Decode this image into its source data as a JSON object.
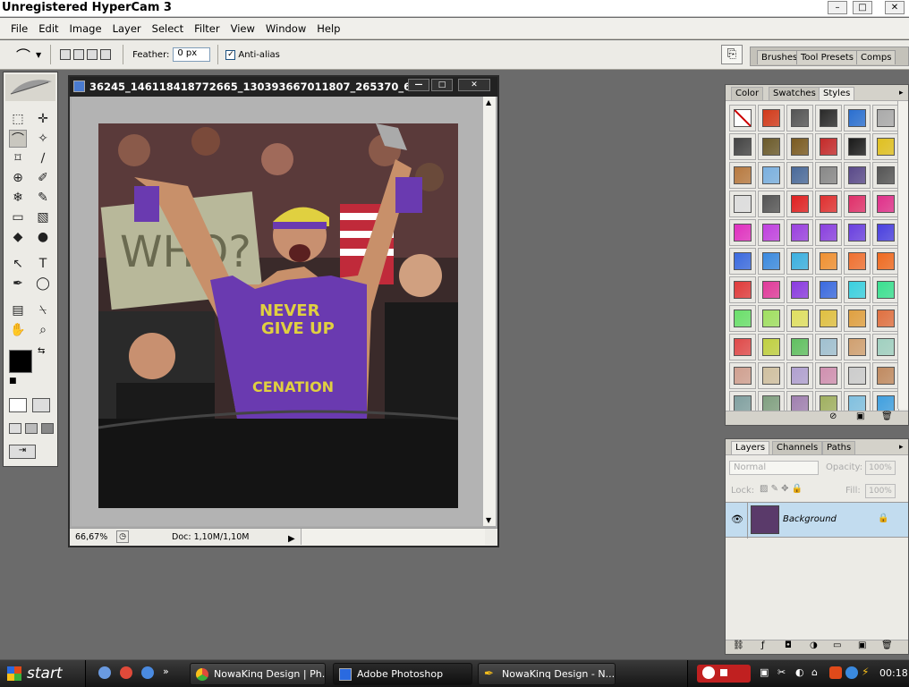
{
  "window": {
    "title": "Unregistered HyperCam 3",
    "min": "–",
    "max": "□",
    "close": "✕"
  },
  "menu": [
    "File",
    "Edit",
    "Image",
    "Layer",
    "Select",
    "Filter",
    "View",
    "Window",
    "Help"
  ],
  "options": {
    "feather_label": "Feather:",
    "feather_value": "0 px",
    "antialias_label": "Anti-alias",
    "antialias_checked": "✓"
  },
  "palette_tabs": [
    "Brushes",
    "Tool Presets",
    "Comps"
  ],
  "toolbox": {
    "icons": [
      "marquee-icon",
      "move-icon",
      "polygonal-lasso-icon",
      "magic-wand-icon",
      "crop-icon",
      "slice-icon",
      "healing-brush-icon",
      "brush-icon",
      "clone-stamp-icon",
      "history-brush-icon",
      "eraser-icon",
      "gradient-icon",
      "blur-icon",
      "dodge-icon",
      "path-selection-icon",
      "type-icon",
      "pen-icon",
      "shape-icon",
      "notes-icon",
      "eyedropper-icon",
      "hand-icon",
      "zoom-icon"
    ],
    "glyphs": [
      "⬚",
      "✛",
      "⌒",
      "✧",
      "⌑",
      "∕",
      "⊕",
      "✐",
      "❄",
      "✎",
      "▭",
      "▧",
      "◆",
      "●",
      "↖",
      "T",
      "✒",
      "◯",
      "▤",
      "⍀",
      "✋",
      "⌕"
    ]
  },
  "document": {
    "title": "36245_146118418772665_130393667011807_265370_6...",
    "zoom": "66,67%",
    "doc_info": "Doc: 1,10M/1,10M",
    "min": "—",
    "max": "□",
    "close": "✕"
  },
  "styles_panel": {
    "tabs": [
      "Color",
      "Swatches",
      "Styles"
    ],
    "active_tab": "Styles",
    "swatches": [
      [
        "#ffffff",
        "#d23a1a",
        "#555555",
        "#2a2a2a",
        "#2a6fd0",
        "#aaaaaa"
      ],
      [
        "#444444",
        "#6b5a2a",
        "#7a5a20",
        "#c42a2a",
        "#1a1a1a",
        "#e0c020"
      ],
      [
        "#b87a40",
        "#7ab0e0",
        "#4a6a9a",
        "#888888",
        "#5a4a8a",
        "#555555"
      ],
      [
        "#dddddd",
        "#555555",
        "#e02020",
        "#e03030",
        "#e0306a",
        "#e0308a"
      ],
      [
        "#e030c0",
        "#c040e0",
        "#9a40e0",
        "#8a40e0",
        "#6a40e0",
        "#4a40e0"
      ],
      [
        "#3a6ae0",
        "#3a8ae0",
        "#3ab0e0",
        "#f09030",
        "#f07030",
        "#f06a20"
      ],
      [
        "#e03a3a",
        "#e03a9a",
        "#8a3ae0",
        "#3a6ae0",
        "#3ad0e0",
        "#3ae090"
      ],
      [
        "#6ae06a",
        "#a0e060",
        "#e0e060",
        "#e0c040",
        "#e0a040",
        "#e07040"
      ],
      [
        "#e04a4a",
        "#c0d040",
        "#60c060",
        "#a0c0d0",
        "#d0a070",
        "#a0d0c0"
      ],
      [
        "#d0a090",
        "#d0c0a0",
        "#b0a0d0",
        "#d090b0",
        "#cccccc",
        "#c08a60"
      ],
      [
        "#80a0a0",
        "#80a080",
        "#a080b0",
        "#a0b060",
        "#80c0e0",
        "#40a0e0"
      ]
    ]
  },
  "layers_panel": {
    "tabs": [
      "Layers",
      "Channels",
      "Paths"
    ],
    "active_tab": "Layers",
    "blend_mode": "Normal",
    "opacity_label": "Opacity:",
    "opacity_value": "100%",
    "lock_label": "Lock:",
    "fill_label": "Fill:",
    "fill_value": "100%",
    "layer_name": "Background"
  },
  "taskbar": {
    "start": "start",
    "tasks": [
      "NowaKinq Design | Ph...",
      "Adobe Photoshop",
      "NowaKinq Design - N..."
    ],
    "clock": "00:18"
  }
}
